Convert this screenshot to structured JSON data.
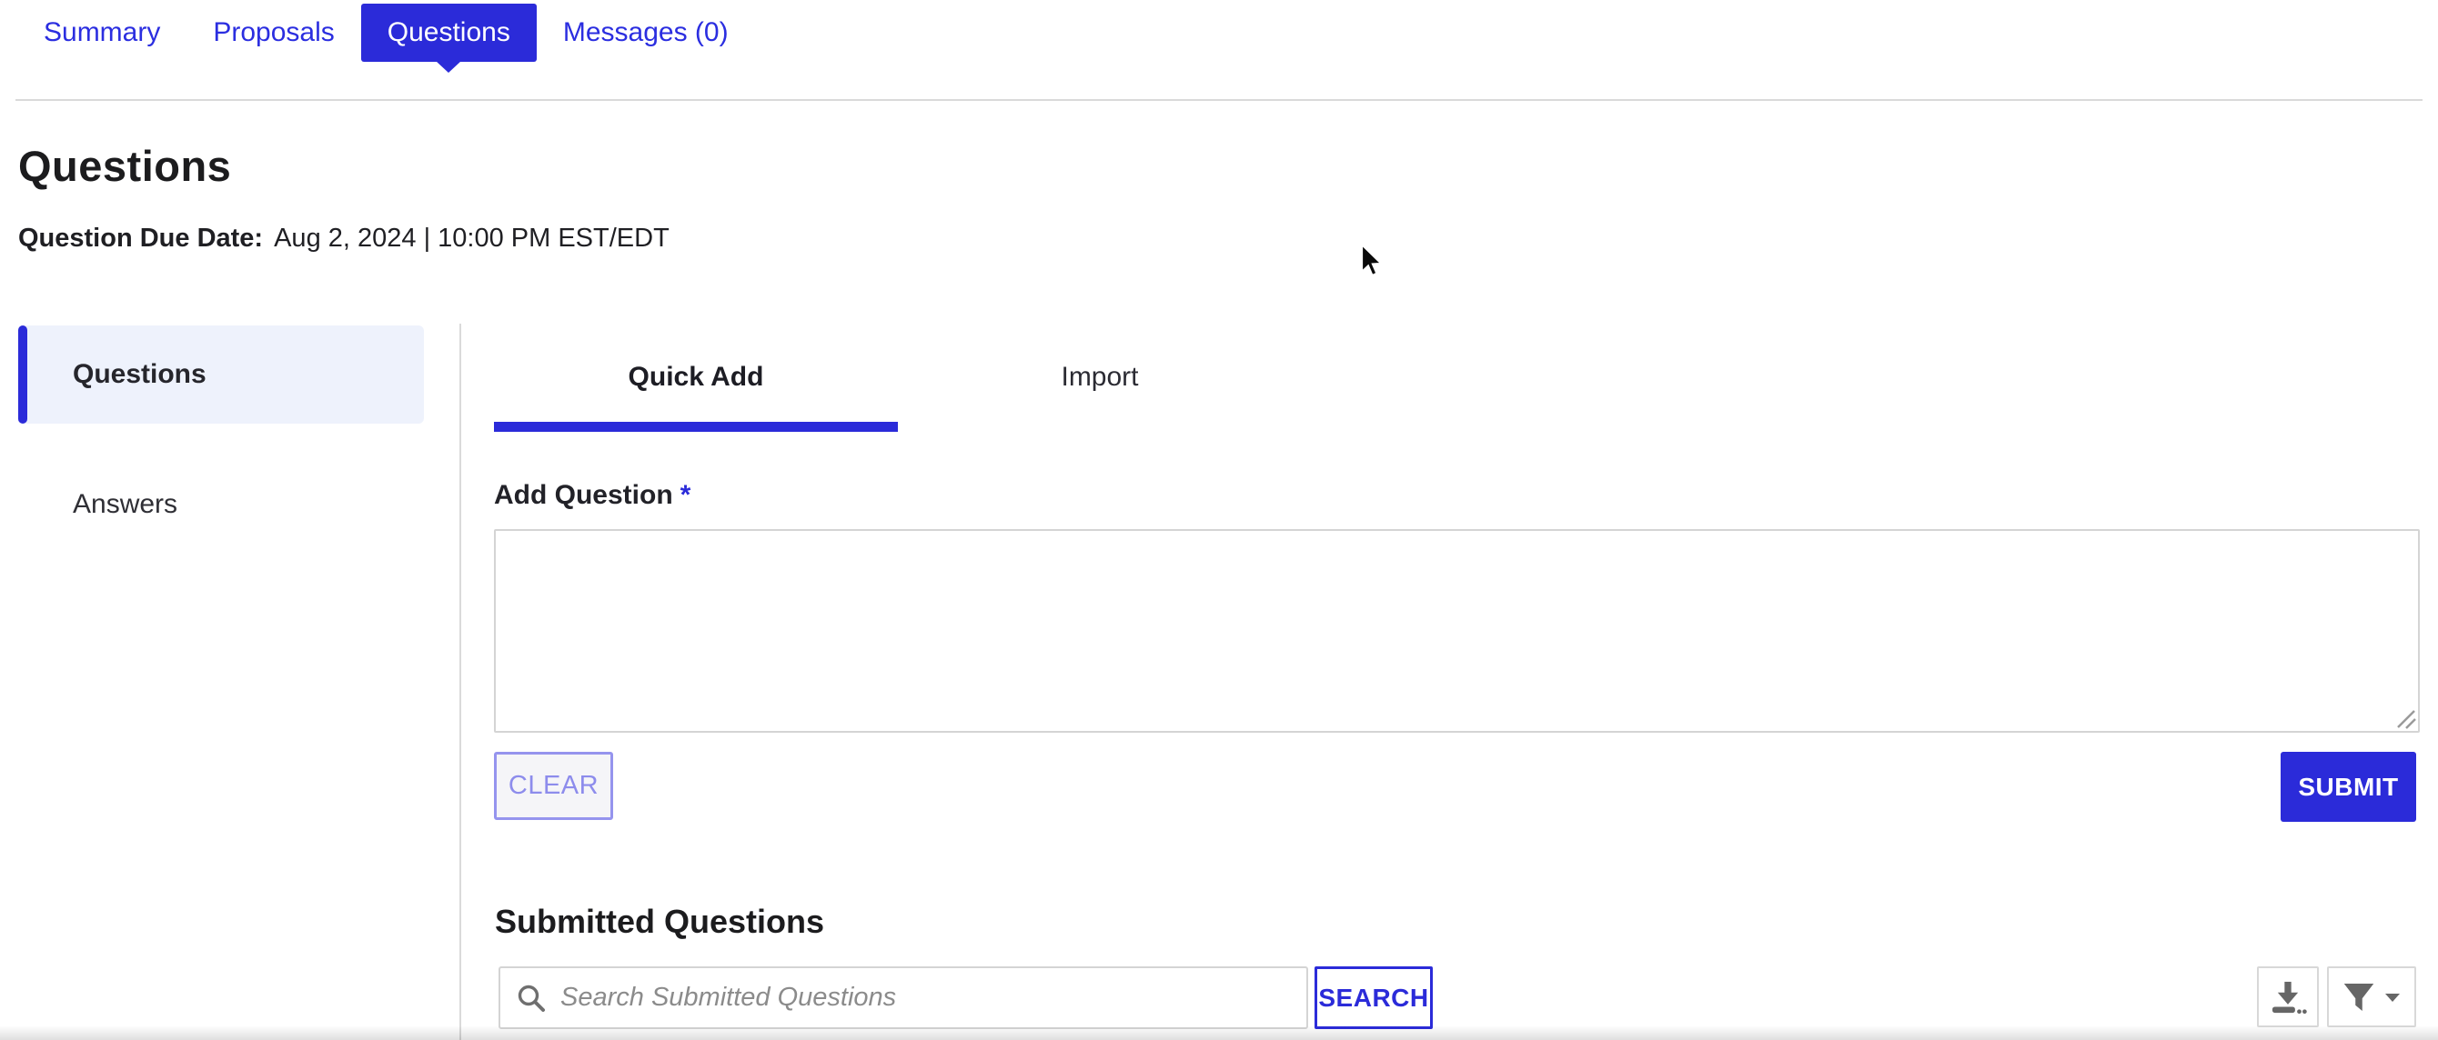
{
  "colors": {
    "accent_blue": "#2b2bd9",
    "nav_link_blue": "#2b2ee0",
    "sidebar_active_bg": "#eef2fc",
    "divider_gray": "#dadada",
    "field_border_gray": "#d4d4d4",
    "clear_button_purple": "#8d8cec",
    "icon_gray": "#666666",
    "text_dark": "#1c1c1e"
  },
  "nav": {
    "tabs": [
      {
        "label": "Summary",
        "active": false
      },
      {
        "label": "Proposals",
        "active": false
      },
      {
        "label": "Questions",
        "active": true
      },
      {
        "label": "Messages (0)",
        "active": false
      }
    ]
  },
  "page": {
    "title": "Questions",
    "due_date_label": "Question Due Date:",
    "due_date_value": "Aug 2, 2024 | 10:00 PM EST/EDT"
  },
  "sidebar": {
    "items": [
      {
        "label": "Questions",
        "active": true
      },
      {
        "label": "Answers",
        "active": false
      }
    ]
  },
  "content": {
    "tabs": [
      {
        "label": "Quick Add",
        "active": true
      },
      {
        "label": "Import",
        "active": false
      }
    ],
    "add_question": {
      "label": "Add Question",
      "required_marker": "*",
      "textarea_value": "",
      "clear_label": "CLEAR",
      "submit_label": "SUBMIT"
    },
    "submitted": {
      "heading": "Submitted Questions",
      "search_placeholder": "Search Submitted Questions",
      "search_button_label": "SEARCH",
      "toolbar_icons": [
        "search-icon",
        "download-icon",
        "filter-icon",
        "chevron-down-icon"
      ]
    }
  }
}
